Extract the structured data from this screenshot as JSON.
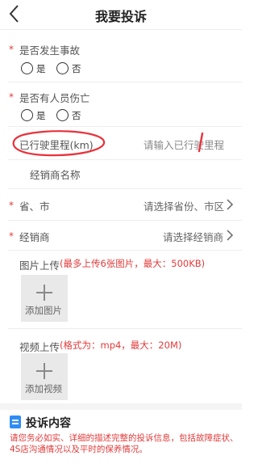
{
  "header": {
    "title": "我要投诉"
  },
  "accident": {
    "label": "是否发生事故",
    "yes": "是",
    "no": "否"
  },
  "injury": {
    "label": "是否有人员伤亡",
    "yes": "是",
    "no": "否"
  },
  "mileage": {
    "label": "已行驶里程(km)",
    "placeholder": "请输入已行驶里程"
  },
  "dealer_name": {
    "label": "经销商名称"
  },
  "province": {
    "label": "省、市",
    "value": "请选择省份、市区"
  },
  "dealer": {
    "label": "经销商",
    "value": "请选择经销商"
  },
  "image_upload": {
    "label": "图片上传",
    "hint": "(最多上传6张图片，最大：500KB)",
    "button": "添加图片"
  },
  "video_upload": {
    "label": "视频上传",
    "hint": "(格式为：mp4，最大：20M)",
    "button": "添加视频"
  },
  "complaint": {
    "title": "投诉内容",
    "notice": "请您务必如实、详细的描述完整的投诉信息，包括故障症状、4S店沟通情况以及平时的保养情况。"
  },
  "colors": {
    "required": "#e23b3b",
    "annotation": "#e8323c",
    "accent": "#2f8df5"
  }
}
